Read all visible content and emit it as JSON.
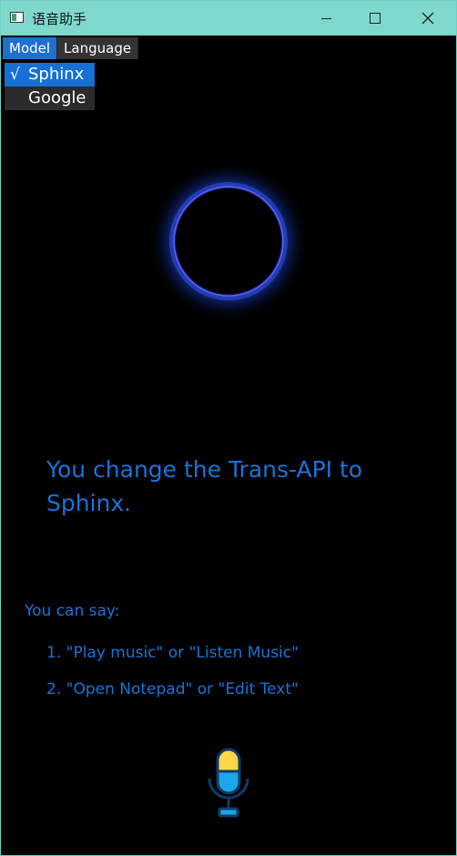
{
  "window": {
    "title": "语音助手"
  },
  "menubar": {
    "items": [
      {
        "label": "Model",
        "active": true
      },
      {
        "label": "Language",
        "active": false
      }
    ]
  },
  "model_menu": {
    "check_mark": "√",
    "options": [
      {
        "label": "Sphinx",
        "selected": true
      },
      {
        "label": "Google",
        "selected": false
      }
    ]
  },
  "status": {
    "message": "You change the Trans-API to Sphinx."
  },
  "hints": {
    "title": "You can say:",
    "items": [
      "1. \"Play music\" or \"Listen Music\"",
      "2. \"Open Notepad\" or \"Edit Text\""
    ]
  },
  "icons": {
    "orb": "voice-activity-orb-icon",
    "microphone": "microphone-icon"
  },
  "colors": {
    "titlebar": "#7fd8cc",
    "accent_text": "#1a73d8",
    "menu_selected": "#1670d6",
    "background": "#000000",
    "mic_top": "#ffd84a",
    "mic_bottom": "#1aa6e8",
    "mic_outline": "#0e3d66"
  }
}
